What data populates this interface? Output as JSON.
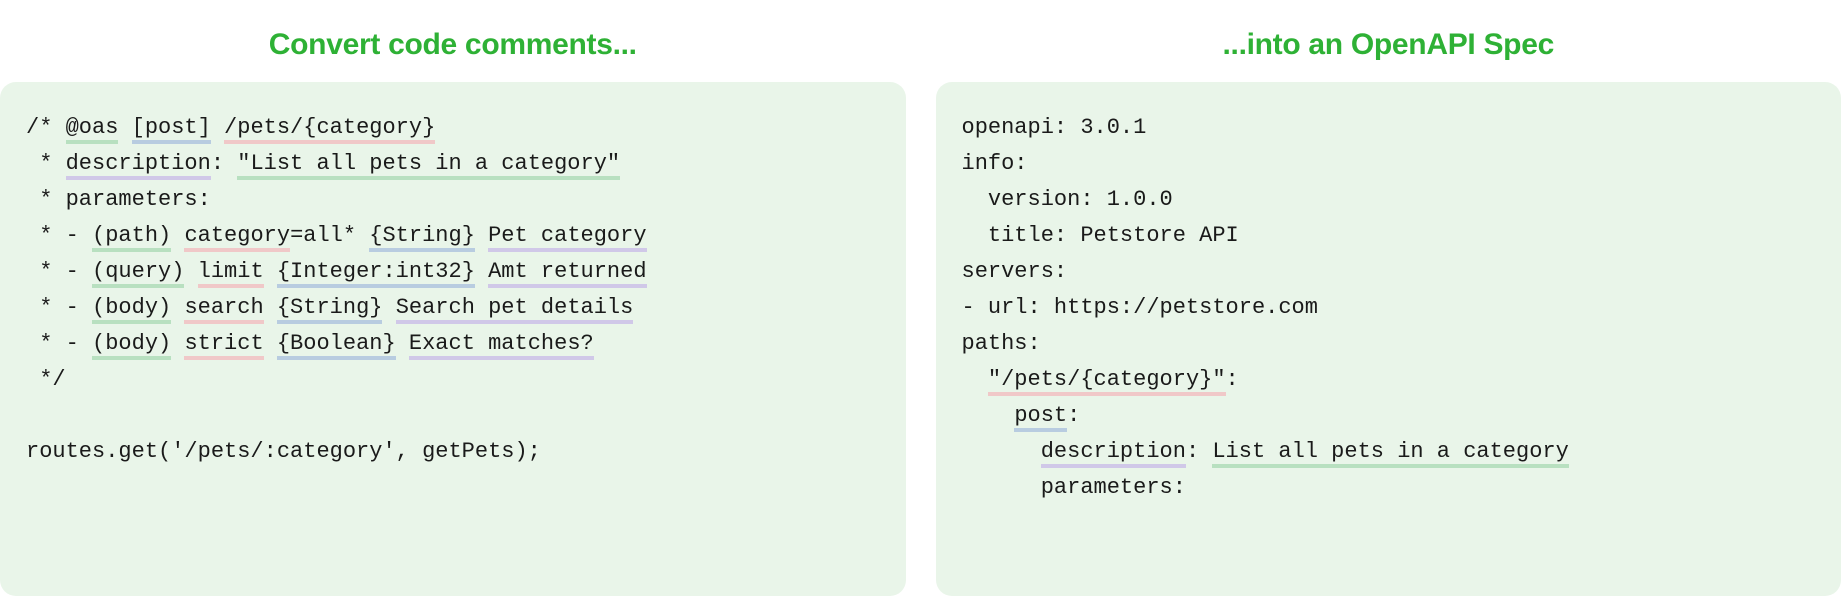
{
  "left": {
    "title": "Convert code comments...",
    "code": [
      [
        {
          "t": "/* ",
          "hl": null
        },
        {
          "t": "@oas",
          "hl": "green"
        },
        {
          "t": " ",
          "hl": null
        },
        {
          "t": "[post]",
          "hl": "blue"
        },
        {
          "t": " ",
          "hl": null
        },
        {
          "t": "/pets/{category}",
          "hl": "pink"
        }
      ],
      [
        {
          "t": " * ",
          "hl": null
        },
        {
          "t": "description",
          "hl": "purple"
        },
        {
          "t": ": ",
          "hl": null
        },
        {
          "t": "\"List all pets in a category\"",
          "hl": "green"
        }
      ],
      [
        {
          "t": " * parameters:",
          "hl": null
        }
      ],
      [
        {
          "t": " * - ",
          "hl": null
        },
        {
          "t": "(path)",
          "hl": "green"
        },
        {
          "t": " ",
          "hl": null
        },
        {
          "t": "category",
          "hl": "pink"
        },
        {
          "t": "=all* ",
          "hl": null
        },
        {
          "t": "{String}",
          "hl": "blue"
        },
        {
          "t": " ",
          "hl": null
        },
        {
          "t": "Pet category",
          "hl": "purple"
        }
      ],
      [
        {
          "t": " * - ",
          "hl": null
        },
        {
          "t": "(query)",
          "hl": "green"
        },
        {
          "t": " ",
          "hl": null
        },
        {
          "t": "limit",
          "hl": "pink"
        },
        {
          "t": " ",
          "hl": null
        },
        {
          "t": "{Integer:int32}",
          "hl": "blue"
        },
        {
          "t": " ",
          "hl": null
        },
        {
          "t": "Amt returned",
          "hl": "purple"
        }
      ],
      [
        {
          "t": " * - ",
          "hl": null
        },
        {
          "t": "(body)",
          "hl": "green"
        },
        {
          "t": " ",
          "hl": null
        },
        {
          "t": "search",
          "hl": "pink"
        },
        {
          "t": " ",
          "hl": null
        },
        {
          "t": "{String}",
          "hl": "blue"
        },
        {
          "t": " ",
          "hl": null
        },
        {
          "t": "Search pet details",
          "hl": "purple"
        }
      ],
      [
        {
          "t": " * - ",
          "hl": null
        },
        {
          "t": "(body)",
          "hl": "green"
        },
        {
          "t": " ",
          "hl": null
        },
        {
          "t": "strict",
          "hl": "pink"
        },
        {
          "t": " ",
          "hl": null
        },
        {
          "t": "{Boolean}",
          "hl": "blue"
        },
        {
          "t": " ",
          "hl": null
        },
        {
          "t": "Exact matches?",
          "hl": "purple"
        }
      ],
      [
        {
          "t": " */",
          "hl": null
        }
      ],
      [
        {
          "t": "",
          "hl": null
        }
      ],
      [
        {
          "t": "routes.get('/pets/:category', getPets);",
          "hl": null
        }
      ]
    ]
  },
  "right": {
    "title": "...into an OpenAPI Spec",
    "code": [
      [
        {
          "t": "openapi: 3.0.1",
          "hl": null
        }
      ],
      [
        {
          "t": "info:",
          "hl": null
        }
      ],
      [
        {
          "t": "  version: 1.0.0",
          "hl": null
        }
      ],
      [
        {
          "t": "  title: Petstore API",
          "hl": null
        }
      ],
      [
        {
          "t": "servers:",
          "hl": null
        }
      ],
      [
        {
          "t": "- url: https://petstore.com",
          "hl": null
        }
      ],
      [
        {
          "t": "paths:",
          "hl": null
        }
      ],
      [
        {
          "t": "  ",
          "hl": null
        },
        {
          "t": "\"/pets/{category}\"",
          "hl": "pink"
        },
        {
          "t": ":",
          "hl": null
        }
      ],
      [
        {
          "t": "    ",
          "hl": null
        },
        {
          "t": "post",
          "hl": "blue"
        },
        {
          "t": ":",
          "hl": null
        }
      ],
      [
        {
          "t": "      ",
          "hl": null
        },
        {
          "t": "description",
          "hl": "purple"
        },
        {
          "t": ": ",
          "hl": null
        },
        {
          "t": "List all pets in a category",
          "hl": "green"
        }
      ],
      [
        {
          "t": "      parameters:",
          "hl": null
        }
      ]
    ]
  }
}
